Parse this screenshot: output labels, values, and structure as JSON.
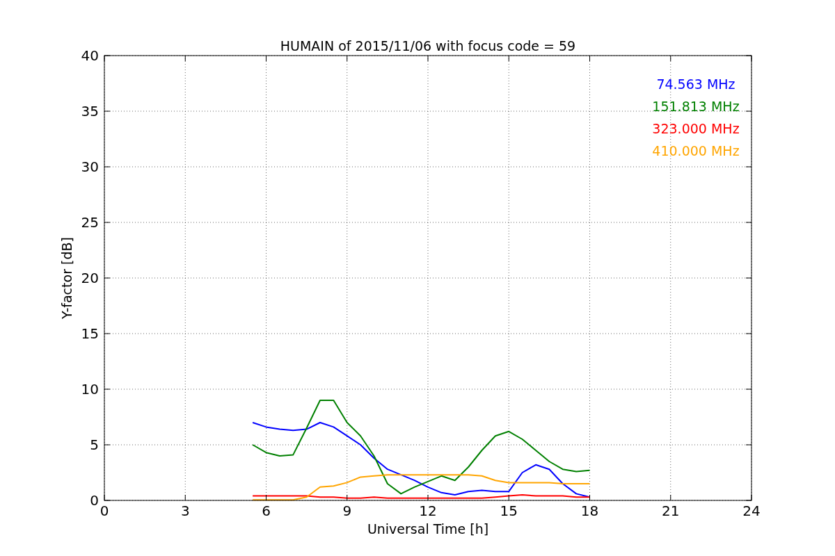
{
  "figure": {
    "chart_data": {
      "type": "line",
      "title": "HUMAIN of 2015/11/06 with focus code = 59",
      "xlabel": "Universal Time [h]",
      "ylabel": "Y-factor [dB]",
      "x": [
        5.5,
        6,
        6.5,
        7,
        7.5,
        8,
        8.5,
        9,
        9.5,
        10,
        10.5,
        11,
        11.5,
        12,
        12.5,
        13,
        13.5,
        14,
        14.5,
        15,
        15.5,
        16,
        16.5,
        17,
        17.5,
        18
      ],
      "series": [
        {
          "name": "74.563 MHz",
          "color": "#0000ff",
          "values": [
            7.0,
            6.6,
            6.4,
            6.3,
            6.4,
            7.0,
            6.6,
            5.8,
            5.0,
            3.8,
            2.8,
            2.3,
            1.8,
            1.2,
            0.7,
            0.5,
            0.8,
            0.9,
            0.8,
            0.8,
            2.5,
            3.2,
            2.8,
            1.5,
            0.6,
            0.3
          ]
        },
        {
          "name": "151.813 MHz",
          "color": "#008000",
          "values": [
            5.0,
            4.3,
            4.0,
            4.1,
            6.5,
            9.0,
            9.0,
            7.0,
            5.8,
            4.0,
            1.5,
            0.6,
            1.2,
            1.7,
            2.2,
            1.8,
            3.0,
            4.5,
            5.8,
            6.2,
            5.5,
            4.5,
            3.5,
            2.8,
            2.6,
            2.7
          ]
        },
        {
          "name": "323.000 MHz",
          "color": "#ff0000",
          "values": [
            0.4,
            0.4,
            0.4,
            0.4,
            0.4,
            0.3,
            0.3,
            0.2,
            0.2,
            0.3,
            0.2,
            0.2,
            0.2,
            0.2,
            0.2,
            0.2,
            0.2,
            0.2,
            0.3,
            0.4,
            0.5,
            0.4,
            0.4,
            0.4,
            0.3,
            0.3
          ]
        },
        {
          "name": "410.000 MHz",
          "color": "#ffa500",
          "values": [
            0.05,
            0.05,
            0.05,
            0.05,
            0.3,
            1.2,
            1.3,
            1.6,
            2.1,
            2.2,
            2.3,
            2.3,
            2.3,
            2.3,
            2.3,
            2.3,
            2.3,
            2.2,
            1.8,
            1.6,
            1.6,
            1.6,
            1.6,
            1.5,
            1.5,
            1.5
          ]
        }
      ],
      "xlim": [
        0,
        24
      ],
      "ylim": [
        0,
        40
      ],
      "xticks": [
        0,
        3,
        6,
        9,
        12,
        15,
        18,
        21,
        24
      ],
      "yticks": [
        0,
        5,
        10,
        15,
        20,
        25,
        30,
        35,
        40
      ],
      "grid": true
    }
  }
}
